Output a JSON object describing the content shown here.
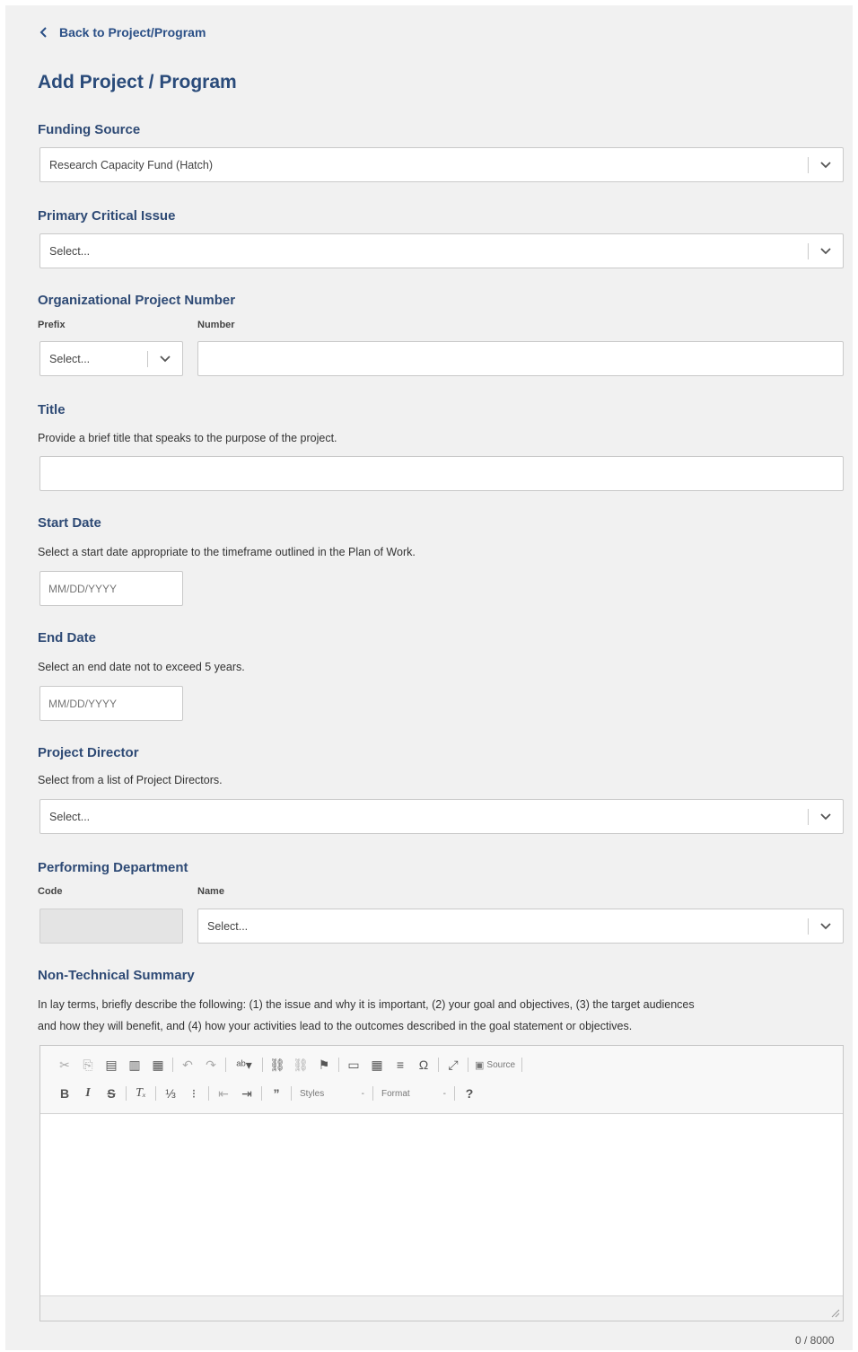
{
  "back_link": "Back to Project/Program",
  "page_title": "Add Project / Program",
  "funding_source": {
    "label": "Funding Source",
    "value": "Research Capacity Fund (Hatch)"
  },
  "primary_critical_issue": {
    "label": "Primary Critical Issue",
    "value": "Select..."
  },
  "org_project_number": {
    "label": "Organizational Project Number",
    "prefix_label": "Prefix",
    "prefix_value": "Select...",
    "number_label": "Number",
    "number_value": ""
  },
  "title": {
    "label": "Title",
    "help": "Provide a brief title that speaks to the purpose of the project.",
    "value": ""
  },
  "start_date": {
    "label": "Start Date",
    "help": "Select a start date appropriate to the timeframe outlined in the Plan of Work.",
    "placeholder": "MM/DD/YYYY"
  },
  "end_date": {
    "label": "End Date",
    "help": "Select an end date not to exceed 5 years.",
    "placeholder": "MM/DD/YYYY"
  },
  "project_director": {
    "label": "Project Director",
    "help": "Select from a list of Project Directors.",
    "value": "Select..."
  },
  "performing_department": {
    "label": "Performing Department",
    "code_label": "Code",
    "name_label": "Name",
    "name_value": "Select..."
  },
  "summary": {
    "label": "Non-Technical Summary",
    "help_line1": "In lay terms, briefly describe the following: (1) the issue and why it is important, (2) your goal and objectives, (3) the target audiences",
    "help_line2": "and how they will benefit, and (4) how your activities lead to the outcomes described in the goal statement or objectives.",
    "counter": "0 / 8000"
  },
  "toolbar": {
    "source_label": "Source",
    "styles_label": "Styles",
    "format_label": "Format",
    "bold": "B",
    "italic": "I",
    "strike": "S",
    "help": "?"
  },
  "colors": {
    "heading": "#2a4b7a",
    "panel_bg": "#f1f1f1",
    "border": "#c9c9c9"
  }
}
